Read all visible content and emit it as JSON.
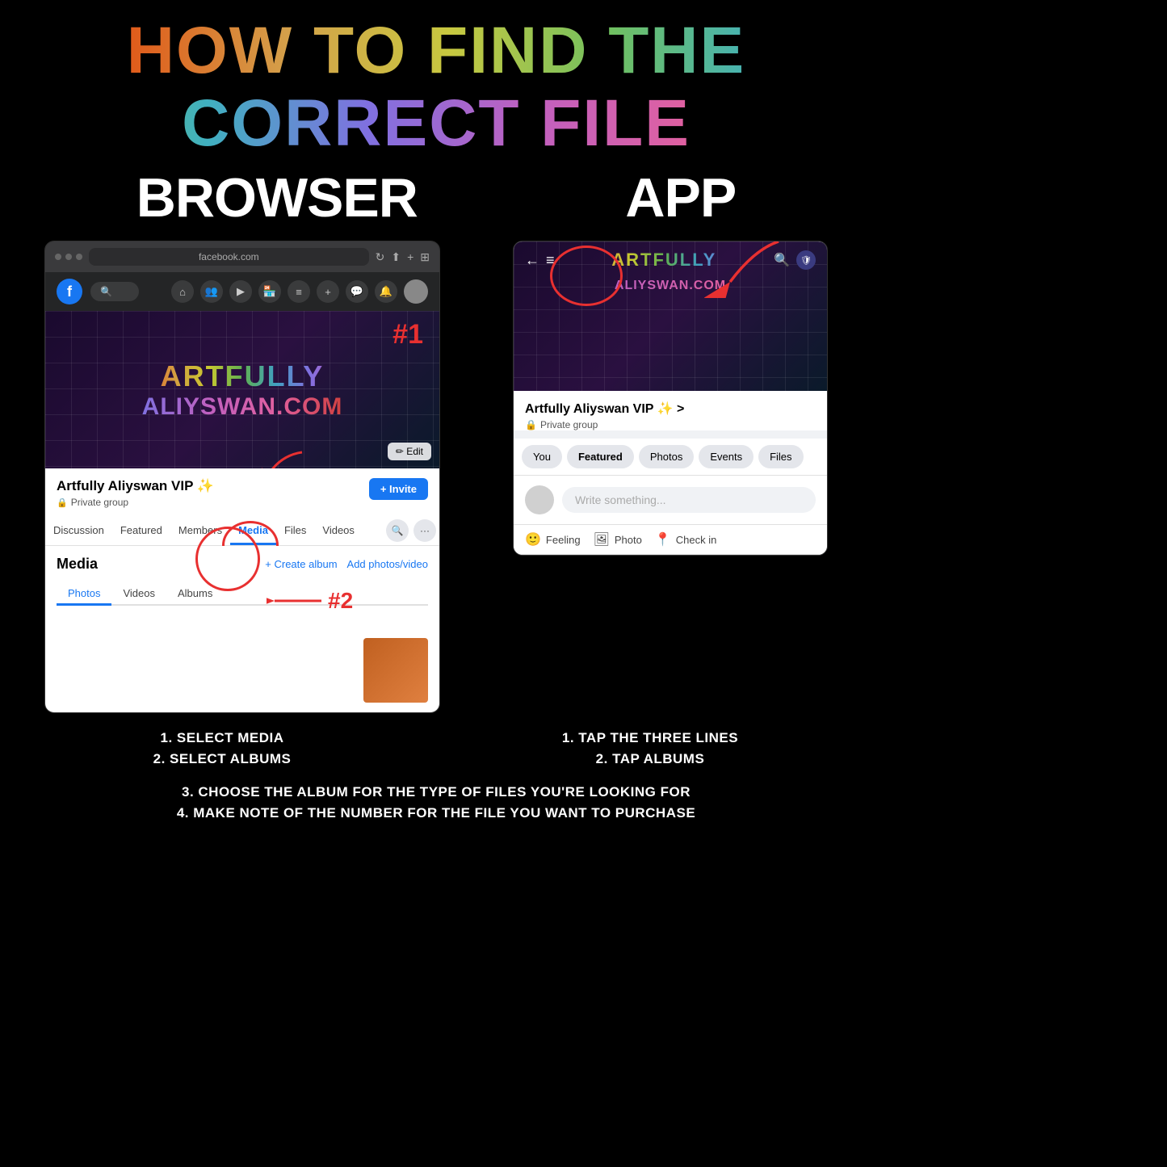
{
  "title": "HOW TO FIND THE CORRECT FILE",
  "sections": {
    "browser": "BROWSER",
    "app": "APP"
  },
  "browser_ui": {
    "url": "facebook.com",
    "group_name": "Artfully Aliyswan VIP ✨",
    "group_privacy": "Private group",
    "cover_line1": "ARTFULLY",
    "cover_line2": "ALIYSWAN.COM",
    "edit_button": "✏ Edit",
    "tabs": [
      "Discussion",
      "Featured",
      "Members",
      "Media",
      "Files",
      "Videos"
    ],
    "active_tab": "Media",
    "media_title": "Media",
    "media_actions": [
      "+ Create album",
      "Add photos/video"
    ],
    "media_sub_tabs": [
      "Photos",
      "Videos",
      "Albums"
    ],
    "active_sub_tab": "Albums",
    "invite_button": "+ Invite",
    "annotation_1": "#1",
    "annotation_2": "#2"
  },
  "app_ui": {
    "group_name": "Artfully Aliyswan VIP ✨ >",
    "group_privacy": "Private group",
    "cover_line1": "ARTFULLY",
    "cover_line2": "ALIYSWAN.COM",
    "tabs": [
      "You",
      "Featured",
      "Photos",
      "Events",
      "Files"
    ],
    "write_placeholder": "Write something...",
    "actions": [
      "Feeling",
      "Photo",
      "Check in"
    ],
    "action_icons": [
      "🙂",
      "🖼",
      "📍"
    ]
  },
  "instructions": {
    "browser_col": {
      "line1": "1. SELECT MEDIA",
      "line2": "2. SELECT ALBUMS"
    },
    "app_col": {
      "line1": "1. TAP THE THREE LINES",
      "line2": "2. TAP ALBUMS"
    },
    "bottom": "3. CHOOSE THE ALBUM FOR THE TYPE OF FILES YOU'RE LOOKING FOR\n4. MAKE NOTE OF THE NUMBER FOR THE FILE YOU WANT TO PURCHASE"
  }
}
